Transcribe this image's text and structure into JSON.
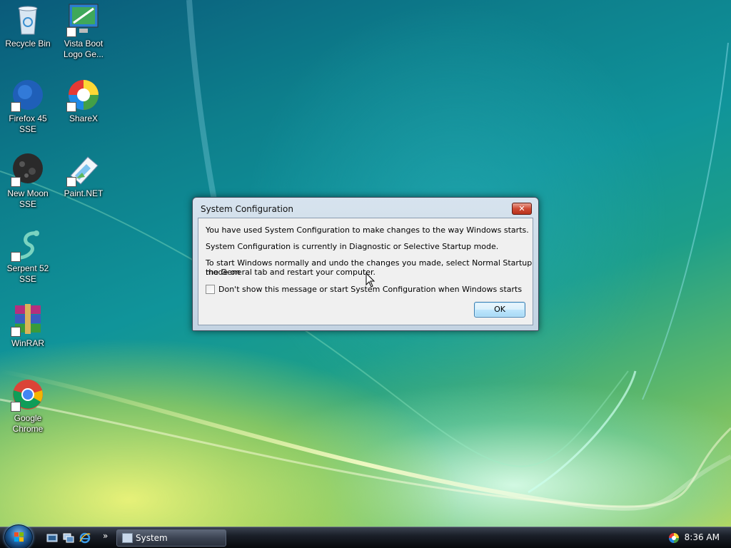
{
  "desktop": {
    "icons": [
      {
        "label_line1": "Recycle Bin",
        "label_line2": ""
      },
      {
        "label_line1": "Vista Boot",
        "label_line2": "Logo Ge..."
      },
      {
        "label_line1": "Firefox 45 SSE",
        "label_line2": ""
      },
      {
        "label_line1": "ShareX",
        "label_line2": ""
      },
      {
        "label_line1": "New Moon",
        "label_line2": "SSE"
      },
      {
        "label_line1": "Paint.NET",
        "label_line2": ""
      },
      {
        "label_line1": "Serpent 52",
        "label_line2": "SSE"
      },
      {
        "label_line1": "WinRAR",
        "label_line2": ""
      },
      {
        "label_line1": "Google",
        "label_line2": "Chrome"
      }
    ]
  },
  "dialog": {
    "title": "System Configuration",
    "close_label": "✕",
    "line1": "You have used System Configuration to make changes to the way Windows starts.",
    "line2": "System Configuration is currently in Diagnostic or Selective Startup mode.",
    "line3a": "To start Windows normally and undo the changes you made, select Normal Startup mode on",
    "line3b": "the General tab and restart your computer.",
    "checkbox_label": "Don't show this message or start System Configuration when Windows starts",
    "checkbox_checked": false,
    "ok_label": "OK"
  },
  "taskbar": {
    "quick_launch_more": "»",
    "task_label": "System Configuration",
    "clock": "8:36 AM"
  },
  "colors": {
    "dialog_frame": "#c3d3e2",
    "ok_button": "#bee6fd",
    "close_button": "#cf4a34",
    "taskbar": "#1a1f28"
  }
}
